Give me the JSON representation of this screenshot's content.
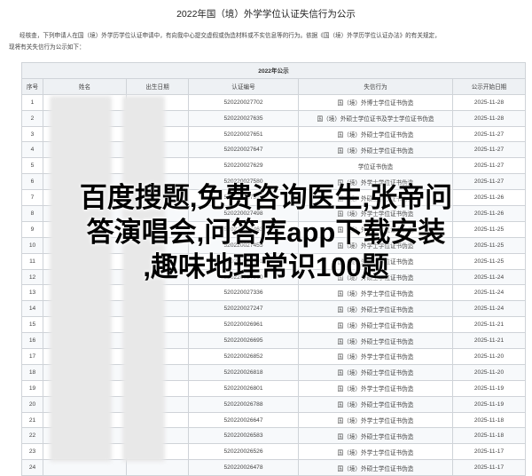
{
  "page": {
    "title": "2022年国（境）外学学位认证失信行为公示",
    "intro_line1": "经核查，下列申请人在国（境）外学历学位认证申请中，有向我中心提交虚假或伪造材料或不实信息等的行为。依据《国（境）外学历学位认证办法》的有关规定，",
    "intro_line2": "现将有关失信行为公示如下："
  },
  "table": {
    "caption": "2022年公示",
    "headers": [
      "序号",
      "姓名",
      "出生日期",
      "认证编号",
      "失信行为",
      "公示开始日期"
    ],
    "rows": [
      [
        "1",
        "",
        "",
        "520220027702",
        "国（境）外博士学位证书伪造",
        "2025-11-28"
      ],
      [
        "2",
        "",
        "",
        "520220027635",
        "国（境）外硕士学位证书及学士学位证书伪造",
        "2025-11-28"
      ],
      [
        "3",
        "",
        "",
        "520220027651",
        "国（境）外硕士学位证书伪造",
        "2025-11-27"
      ],
      [
        "4",
        "",
        "",
        "520220027647",
        "国（境）外硕士学位证书伪造",
        "2025-11-27"
      ],
      [
        "5",
        "",
        "",
        "520220027629",
        "学位证书伪造",
        "2025-11-27"
      ],
      [
        "6",
        "",
        "",
        "520220027580",
        "国（境）外学士学位证书伪造",
        "2025-11-27"
      ],
      [
        "7",
        "",
        "",
        "520220027512",
        "国（境）外硕士学位证书伪造",
        "2025-11-26"
      ],
      [
        "8",
        "",
        "",
        "520220027498",
        "国（境）外学士学位证书伪造",
        "2025-11-26"
      ],
      [
        "9",
        "",
        "",
        "520220027463",
        "国（境）外硕士学位证书伪造",
        "2025-11-25"
      ],
      [
        "10",
        "",
        "",
        "520220027455",
        "国（境）外学士学位证书伪造",
        "2025-11-25"
      ],
      [
        "11",
        "",
        "",
        "520220027401",
        "国（境）外硕士学位证书伪造",
        "2025-11-25"
      ],
      [
        "12",
        "",
        "",
        "520220027360",
        "国（境）外硕士学位证书伪造",
        "2025-11-24"
      ],
      [
        "13",
        "",
        "",
        "520220027336",
        "国（境）外学士学位证书伪造",
        "2025-11-24"
      ],
      [
        "14",
        "",
        "",
        "520220027247",
        "国（境）外硕士学位证书伪造",
        "2025-11-24"
      ],
      [
        "15",
        "",
        "",
        "520220026961",
        "国（境）外硕士学位证书伪造",
        "2025-11-21"
      ],
      [
        "16",
        "",
        "",
        "520220026695",
        "国（境）外硕士学位证书伪造",
        "2025-11-21"
      ],
      [
        "17",
        "",
        "",
        "520220026852",
        "国（境）外学士学位证书伪造",
        "2025-11-20"
      ],
      [
        "18",
        "",
        "",
        "520220026818",
        "国（境）外硕士学位证书伪造",
        "2025-11-20"
      ],
      [
        "19",
        "",
        "",
        "520220026801",
        "国（境）外学士学位证书伪造",
        "2025-11-19"
      ],
      [
        "20",
        "",
        "",
        "520220026788",
        "国（境）外硕士学位证书伪造",
        "2025-11-19"
      ],
      [
        "21",
        "",
        "",
        "520220026647",
        "国（境）外学士学位证书伪造",
        "2025-11-18"
      ],
      [
        "22",
        "",
        "",
        "520220026583",
        "国（境）外硕士学位证书伪造",
        "2025-11-18"
      ],
      [
        "23",
        "",
        "",
        "520220026526",
        "国（境）外学士学位证书伪造",
        "2025-11-17"
      ],
      [
        "24",
        "",
        "",
        "520220026478",
        "国（境）外硕士学位证书伪造",
        "2025-11-17"
      ]
    ]
  },
  "overlay": {
    "line1": "百度搜题,免费咨询医生,张帝问",
    "line2": "答演唱会,问答库app下载安装",
    "line3": ",趣味地理常识100题"
  }
}
